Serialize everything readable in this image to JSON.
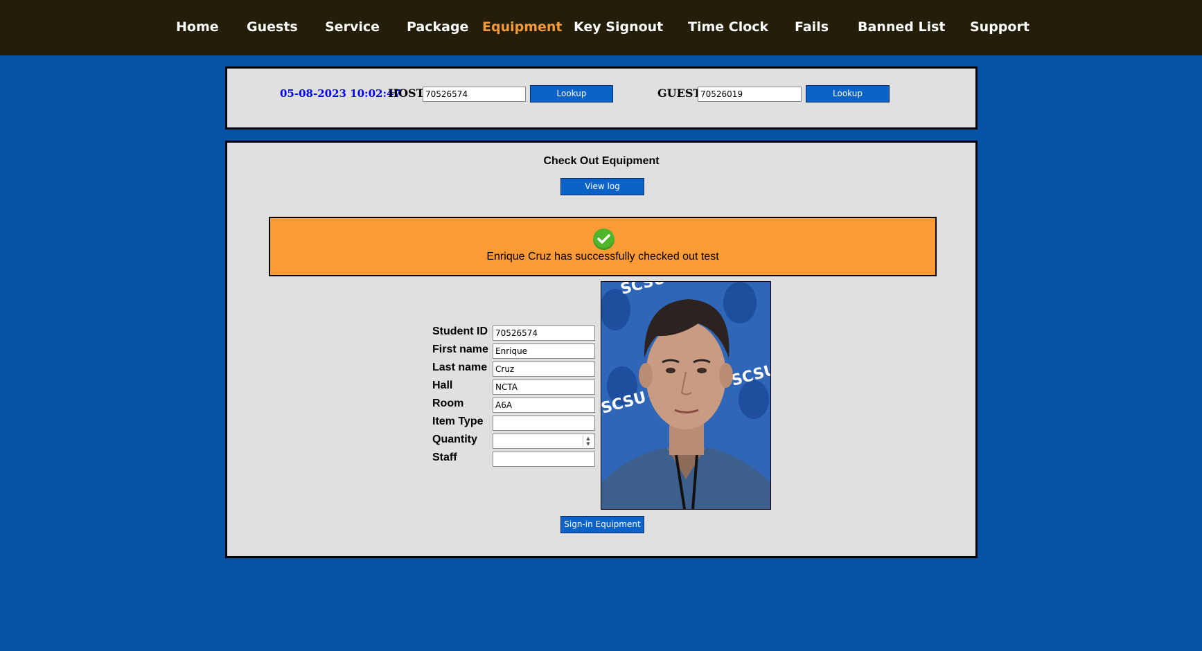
{
  "nav": {
    "items": [
      "Home",
      "Guests",
      "Service",
      "Package",
      "Equipment",
      "Key Signout",
      "Time Clock",
      "Fails",
      "Banned List",
      "Support"
    ],
    "active": "Equipment"
  },
  "lookup": {
    "datetime": "05-08-2023 10:02:47",
    "host_label": "HOST",
    "host_value": "70526574",
    "guest_label": "GUEST",
    "guest_value": "70526019",
    "lookup_label": "Lookup"
  },
  "main": {
    "title": "Check Out Equipment",
    "view_log_label": "View log",
    "alert_message": "Enrique Cruz has successfully checked out test",
    "submit_label": "Sign-in Equipment"
  },
  "form": {
    "student_id_label": "Student ID",
    "student_id": "70526574",
    "first_name_label": "First name",
    "first_name": "Enrique",
    "last_name_label": "Last name",
    "last_name": "Cruz",
    "hall_label": "Hall",
    "hall": "NCTA",
    "room_label": "Room",
    "room": "A6A",
    "item_type_label": "Item Type",
    "item_type": "",
    "quantity_label": "Quantity",
    "quantity": "",
    "staff_label": "Staff",
    "staff": ""
  },
  "photo": {
    "backdrop_text": "SCSU"
  },
  "colors": {
    "page_bg": "#0653a5",
    "nav_bg": "#241e08",
    "nav_active": "#f49a3b",
    "button_blue": "#0b62c8",
    "alert_orange": "#fd9b37",
    "datetime_blue": "#0000ff",
    "success_green": "#4fb52b"
  },
  "icons": {
    "success": "check-circle-icon"
  }
}
